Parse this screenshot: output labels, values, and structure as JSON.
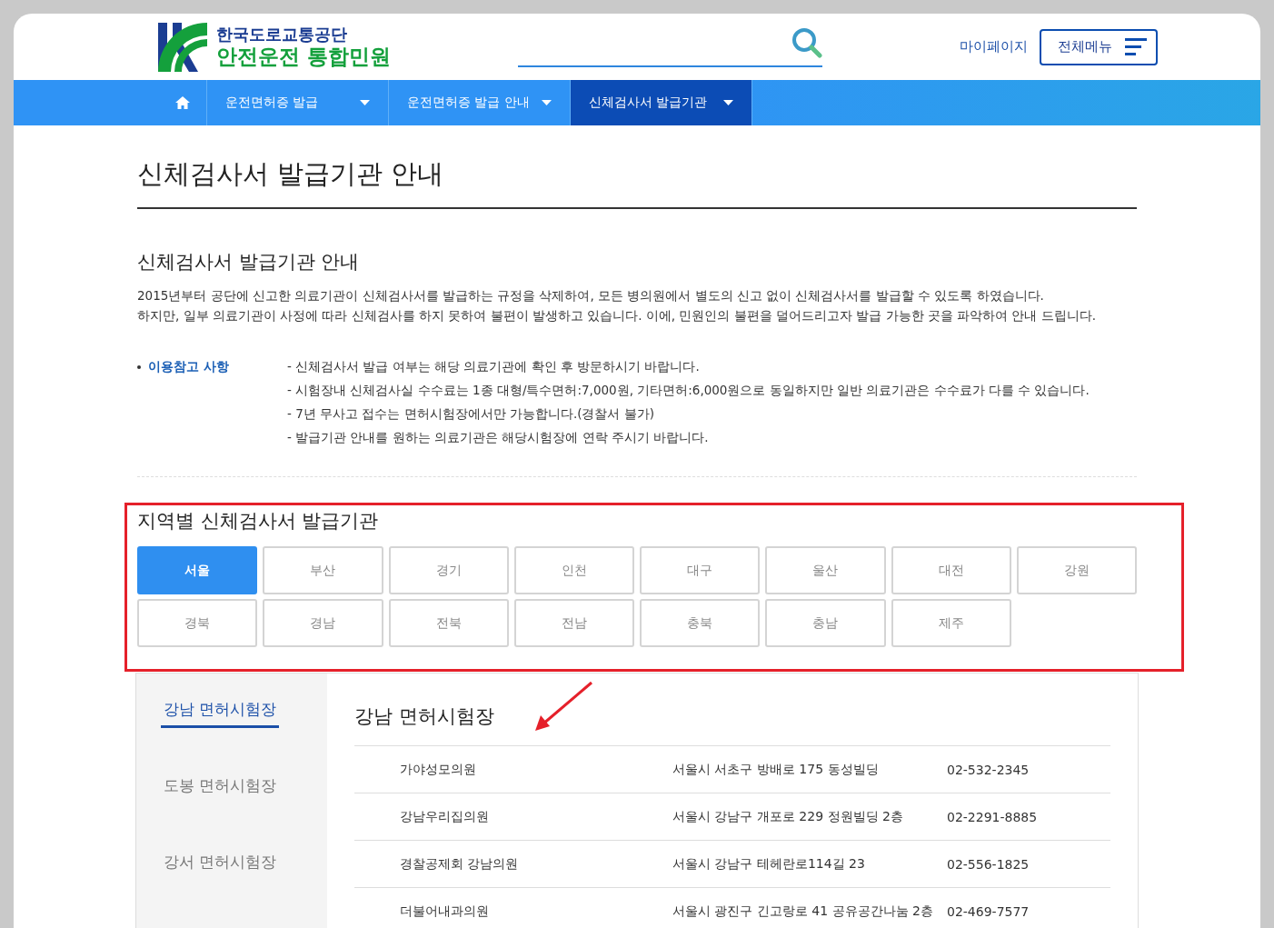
{
  "header": {
    "org_name": "한국도로교통공단",
    "site_name": "안전운전 통합민원",
    "my_page": "마이페이지",
    "all_menu": "전체메뉴"
  },
  "nav": [
    {
      "label": "운전면허증 발급",
      "selected": false
    },
    {
      "label": "운전면허증 발급 안내",
      "selected": false
    },
    {
      "label": "신체검사서 발급기관",
      "selected": true
    }
  ],
  "page_title": "신체검사서 발급기관 안내",
  "intro": {
    "heading": "신체검사서 발급기관 안내",
    "paragraphs": [
      "2015년부터 공단에 신고한 의료기관이 신체검사서를 발급하는 규정을 삭제하여, 모든 병의원에서 별도의 신고 없이 신체검사서를 발급할 수 있도록 하였습니다.",
      "하지만, 일부 의료기관이 사정에 따라 신체검사를 하지 못하여 불편이 발생하고 있습니다. 이에, 민원인의 불편을 덜어드리고자 발급 가능한 곳을 파악하여 안내 드립니다."
    ]
  },
  "notes": {
    "label": "이용참고 사항",
    "items": [
      "- 신체검사서 발급 여부는 해당 의료기관에 확인 후 방문하시기 바랍니다.",
      "- 시험장내 신체검사실 수수료는 1종 대형/특수면허:7,000원, 기타면허:6,000원으로 동일하지만 일반 의료기관은 수수료가 다를 수 있습니다.",
      "- 7년 무사고 접수는 면허시험장에서만 가능합니다.(경찰서 불가)",
      "- 발급기관 안내를 원하는 의료기관은 해당시험장에 연락 주시기 바랍니다."
    ]
  },
  "regions": {
    "heading": "지역별 신체검사서 발급기관",
    "items": [
      {
        "label": "서울",
        "selected": true
      },
      {
        "label": "부산",
        "selected": false
      },
      {
        "label": "경기",
        "selected": false
      },
      {
        "label": "인천",
        "selected": false
      },
      {
        "label": "대구",
        "selected": false
      },
      {
        "label": "울산",
        "selected": false
      },
      {
        "label": "대전",
        "selected": false
      },
      {
        "label": "강원",
        "selected": false
      },
      {
        "label": "경북",
        "selected": false
      },
      {
        "label": "경남",
        "selected": false
      },
      {
        "label": "전북",
        "selected": false
      },
      {
        "label": "전남",
        "selected": false
      },
      {
        "label": "충북",
        "selected": false
      },
      {
        "label": "충남",
        "selected": false
      },
      {
        "label": "제주",
        "selected": false
      }
    ]
  },
  "centers": [
    {
      "label": "강남 면허시험장",
      "selected": true
    },
    {
      "label": "도봉 면허시험장",
      "selected": false
    },
    {
      "label": "강서 면허시험장",
      "selected": false
    }
  ],
  "detail": {
    "title": "강남 면허시험장",
    "rows": [
      [
        "가야성모의원",
        "서울시 서초구 방배로 175 동성빌딩",
        "02-532-2345"
      ],
      [
        "강남우리집의원",
        "서울시 강남구 개포로 229 정원빌딩 2층",
        "02-2291-8885"
      ],
      [
        "경찰공제회 강남의원",
        "서울시 강남구 테헤란로114길 23",
        "02-556-1825"
      ],
      [
        "더불어내과의원",
        "서울시 광진구 긴고랑로 41 공유공간나눔 2층",
        "02-469-7577"
      ]
    ]
  }
}
